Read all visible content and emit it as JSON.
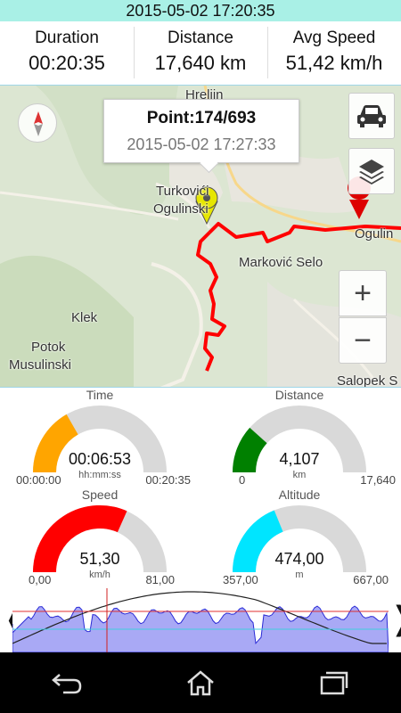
{
  "status_bar": {
    "datetime": "2015-05-02 17:20:35"
  },
  "stats": [
    {
      "label": "Duration",
      "value": "00:20:35"
    },
    {
      "label": "Distance",
      "value": "17,640 km"
    },
    {
      "label": "Avg Speed",
      "value": "51,42 km/h"
    }
  ],
  "map": {
    "labels": [
      "Hreljin",
      "Turkovići",
      "Ogulinski",
      "Marković Selo",
      "Klek",
      "Potok",
      "Musulinski",
      "Ogulin",
      "Salopek S"
    ],
    "tooltip": {
      "point": "Point:174/693",
      "time": "2015-05-02 17:27:33"
    },
    "buttons": {
      "vehicle": "car-icon",
      "layers": "layers-icon",
      "zoom_in": "+",
      "zoom_out": "−"
    },
    "colors": {
      "track": "#ff0000",
      "marker": "#e6e600"
    }
  },
  "gauges": {
    "time": {
      "title": "Time",
      "value": "00:06:53",
      "unit": "hh:mm:ss",
      "min": "00:00:00",
      "max": "00:20:35",
      "fraction": 0.334,
      "color": "#ffa500"
    },
    "distance": {
      "title": "Distance",
      "value": "4,107",
      "unit": "km",
      "min": "0",
      "max": "17,640",
      "fraction": 0.233,
      "color": "#008000"
    },
    "speed": {
      "title": "Speed",
      "value": "51,30",
      "unit": "km/h",
      "min": "0,00",
      "max": "81,00",
      "fraction": 0.633,
      "color": "#ff0000"
    },
    "altitude": {
      "title": "Altitude",
      "value": "474,00",
      "unit": "m",
      "min": "357,00",
      "max": "667,00",
      "fraction": 0.377,
      "color": "#00e5ff"
    }
  },
  "profile": {
    "left_arrow": "❬",
    "right_arrow": "❭",
    "cursor_fraction": 0.2511
  },
  "nav": {
    "back": "back-icon",
    "home": "home-icon",
    "recents": "recents-icon"
  }
}
